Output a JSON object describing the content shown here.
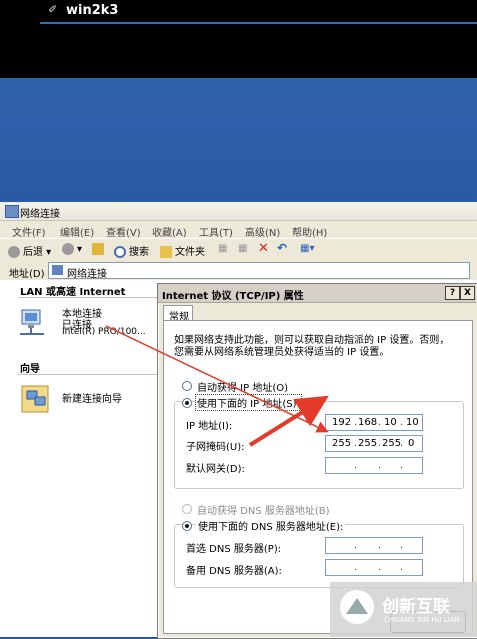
{
  "session": {
    "title": "win2k3"
  },
  "netwin": {
    "title": "网络连接",
    "menu": [
      "文件(F)",
      "编辑(E)",
      "查看(V)",
      "收藏(A)",
      "工具(T)",
      "高级(N)",
      "帮助(H)"
    ],
    "toolbar": {
      "back": "后退",
      "search": "搜索",
      "folders": "文件夹"
    },
    "address_label": "地址(D)",
    "address_value": "网络连接",
    "section_lan": "LAN 或高速 Internet",
    "conn_name": "本地连接",
    "conn_status": "已连接",
    "conn_device": "Intel(R) PRO/100...",
    "section_wizard": "向导",
    "wizard_label": "新建连接向导"
  },
  "dialog": {
    "title": "Internet 协议 (TCP/IP) 属性",
    "help_btn": "?",
    "close_btn": "X",
    "tab": "常规",
    "desc_line1": "如果网络支持此功能，则可以获取自动指派的 IP 设置。否则，",
    "desc_line2": "您需要从网络系统管理员处获得适当的 IP 设置。",
    "auto_ip": "自动获得 IP 地址(O)",
    "use_ip": "使用下面的 IP 地址(S):",
    "ip_label": "IP 地址(I):",
    "mask_label": "子网掩码(U):",
    "gw_label": "默认网关(D):",
    "ip": [
      "192",
      "168",
      "10",
      "10"
    ],
    "mask": [
      "255",
      "255",
      "255",
      "0"
    ],
    "auto_dns": "自动获得 DNS 服务器地址(B)",
    "use_dns": "使用下面的 DNS 服务器地址(E):",
    "dns1_label": "首选 DNS 服务器(P):",
    "dns2_label": "备用 DNS 服务器(A):"
  },
  "watermark": {
    "brand": "创新互联",
    "sub": "CHUANG XIN HU LIAN"
  },
  "colors": {
    "arrow": "#e53a2a",
    "desktop": "#2b5aa0"
  }
}
